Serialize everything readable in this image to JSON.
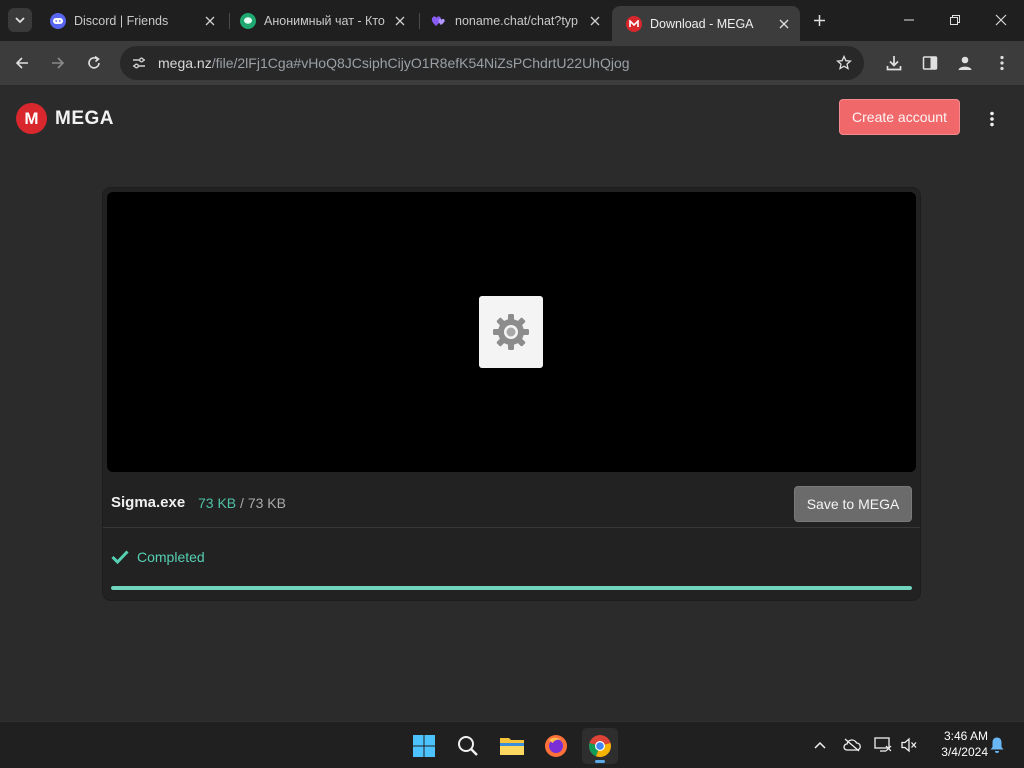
{
  "browser": {
    "tabs": [
      {
        "title": "Discord | Friends",
        "favicon": "discord-icon",
        "active": false
      },
      {
        "title": "Анонимный чат - Кто",
        "favicon": "chat-bubble-icon",
        "active": false
      },
      {
        "title": "noname.chat/chat?typ",
        "favicon": "hearts-icon",
        "active": false
      },
      {
        "title": "Download - MEGA",
        "favicon": "mega-icon",
        "active": true
      }
    ],
    "address": {
      "host": "mega.nz",
      "path": "/file/2lFj1Cga#vHoQ8JCsiphCijyO1R8efK54NiZsPChdrtU22UhQjog"
    }
  },
  "mega": {
    "logo_letter": "M",
    "logo_text": "MEGA",
    "create_account_label": "Create account",
    "file": {
      "name": "Sigma.exe",
      "downloaded": "73 KB",
      "separator": "/",
      "total": "73 KB",
      "save_label": "Save to MEGA",
      "status": "Completed",
      "progress_fraction": 1.0
    },
    "colors": {
      "brand_red": "#d9272e",
      "create_button": "#f0686a",
      "progress": "#6fd6bd",
      "status_text": "#56d0b2"
    }
  },
  "taskbar": {
    "apps": [
      "windows-start-icon",
      "search-icon",
      "file-explorer-icon",
      "firefox-icon",
      "chrome-icon"
    ],
    "clock": {
      "time": "3:46 AM",
      "date": "3/4/2024"
    }
  }
}
